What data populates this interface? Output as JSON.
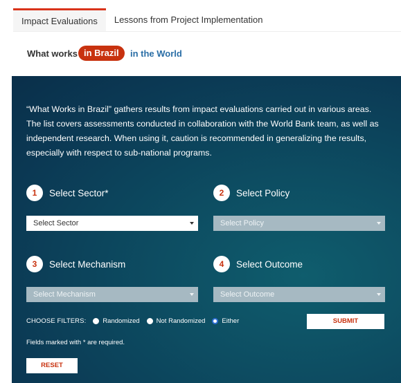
{
  "tabs": [
    {
      "label": "Impact Evaluations"
    },
    {
      "label": "Lessons from Project Implementation"
    }
  ],
  "subnav": {
    "label": "What works",
    "brazil": "in Brazil",
    "world": "in the World"
  },
  "description": "“What Works in Brazil” gathers results from impact evaluations carried out in various areas. The list covers assessments conducted in collaboration with the World Bank team, as well as independent research. When using it, caution is recommended in generalizing the results, especially with respect to sub-national programs.",
  "steps": [
    {
      "num": "1",
      "label": "Select Sector*",
      "placeholder": "Select Sector"
    },
    {
      "num": "2",
      "label": "Select Policy",
      "placeholder": "Select Policy"
    },
    {
      "num": "3",
      "label": "Select Mechanism",
      "placeholder": "Select Mechanism"
    },
    {
      "num": "4",
      "label": "Select Outcome",
      "placeholder": "Select Outcome"
    }
  ],
  "filters": {
    "label": "CHOOSE FILTERS:",
    "options": [
      "Randomized",
      "Not Randomized",
      "Either"
    ],
    "selected": "Either"
  },
  "submit_label": "SUBMIT",
  "required_note": "Fields marked with * are required.",
  "reset_label": "RESET",
  "colors": {
    "accent": "#c8320f",
    "link": "#2a6ea6",
    "panel": "#0b3954"
  }
}
